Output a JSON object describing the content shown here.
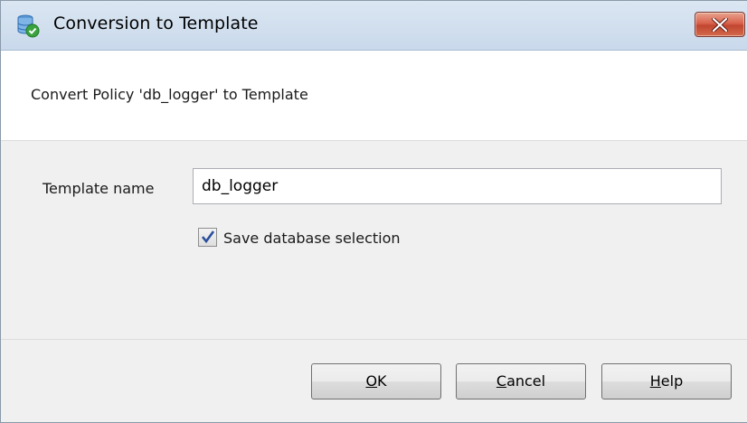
{
  "window": {
    "title": "Conversion to Template",
    "close_icon": "close-icon"
  },
  "header": {
    "text": "Convert Policy 'db_logger' to Template"
  },
  "form": {
    "template_name_label": "Template name",
    "template_name_value": "db_logger",
    "save_selection_label": "Save database selection",
    "save_selection_checked": true
  },
  "buttons": {
    "ok": {
      "accel": "O",
      "rest": "K"
    },
    "cancel": {
      "accel": "C",
      "rest": "ancel"
    },
    "help": {
      "accel": "H",
      "rest": "elp"
    }
  },
  "colors": {
    "close_button": "#c14630",
    "titlebar": "#c9d9eb",
    "checkmark": "#2a4f9c"
  }
}
